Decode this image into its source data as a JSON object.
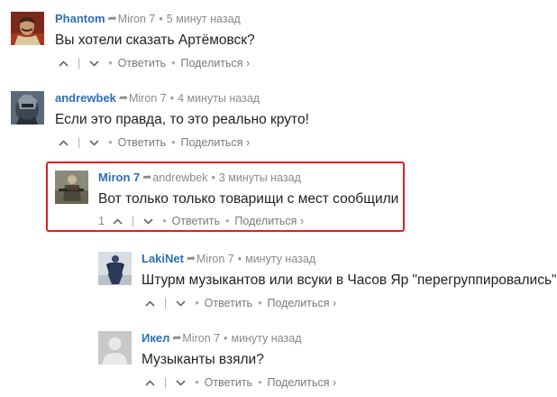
{
  "comments": [
    {
      "author": "Phantom",
      "reply_to": "Miron 7",
      "time": "5 минут назад",
      "text": "Вы хотели сказать Артёмовск?",
      "votes": "",
      "reply_label": "Ответить",
      "share_label": "Поделиться ›",
      "avatar": "avatar-stalin"
    },
    {
      "author": "andrewbek",
      "reply_to": "Miron 7",
      "time": "4 минуты назад",
      "text": "Если это правда, то это реально круто!",
      "votes": "",
      "reply_label": "Ответить",
      "share_label": "Поделиться ›",
      "avatar": "avatar-bear"
    },
    {
      "author": "Miron 7",
      "reply_to": "andrewbek",
      "time": "3 минуты назад",
      "text": "Вот только только товарищи с мест сообщили",
      "votes": "1",
      "reply_label": "Ответить",
      "share_label": "Поделиться ›",
      "avatar": "avatar-soldier"
    },
    {
      "author": "LakiNet",
      "reply_to": "Miron 7",
      "time": "минуту назад",
      "text": "Штурм музыкантов или всуки в Часов Яр \"перегруппировались\"?",
      "votes": "",
      "reply_label": "Ответить",
      "share_label": "Поделиться ›",
      "avatar": "avatar-figure"
    },
    {
      "author": "Икел",
      "reply_to": "Miron 7",
      "time": "минуту назад",
      "text": "Музыканты взяли?",
      "votes": "",
      "reply_label": "Ответить",
      "share_label": "Поделиться ›",
      "avatar": "avatar-default"
    }
  ],
  "colors": {
    "author": "#2a6fb5",
    "meta": "#8a8a8a",
    "highlight_border": "#e02020"
  }
}
